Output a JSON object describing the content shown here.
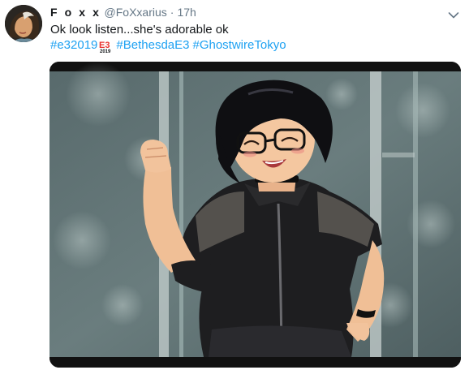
{
  "tweet": {
    "display_name": "F o x x",
    "handle": "@FoXxarius",
    "separator": "·",
    "timestamp": "17h",
    "text": "Ok look listen...she's adorable ok",
    "hashtags": [
      "#e32019",
      "#BethesdaE3",
      "#GhostwireTokyo"
    ],
    "hashflag": {
      "label": "E3",
      "year": "2019"
    }
  },
  "icons": {
    "menu": "chevron-down-icon",
    "avatar": "avatar-image",
    "media": "anime-character-image"
  },
  "colors": {
    "text": "#14171a",
    "secondary": "#657786",
    "link": "#1da1f2",
    "hashflag_red": "#e8322d"
  }
}
